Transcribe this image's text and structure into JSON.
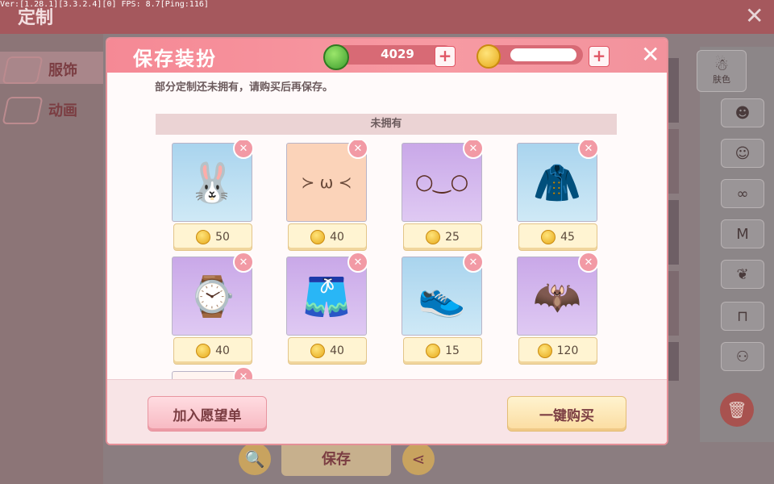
{
  "debug_text": "Ver:[1.28.1][3.3.2.4][0] FPS: 8.7[Ping:116]",
  "background": {
    "title": "定制",
    "close": "✕",
    "left_tabs": [
      {
        "label": "服饰",
        "icon": "clothing-icon"
      },
      {
        "label": "动画",
        "icon": "animation-icon"
      }
    ],
    "right_categories": [
      {
        "label": "肤色",
        "icon": "skin-color-icon",
        "glyph": "☃"
      },
      {
        "label": "",
        "icon": "face-icon",
        "glyph": "☻"
      },
      {
        "label": "",
        "icon": "face-makeup-icon",
        "glyph": "☺"
      },
      {
        "label": "",
        "icon": "mask-icon",
        "glyph": "∞"
      },
      {
        "label": "",
        "icon": "shirt-icon",
        "glyph": "M"
      },
      {
        "label": "",
        "icon": "hair-icon",
        "glyph": "❦"
      },
      {
        "label": "",
        "icon": "pants-icon",
        "glyph": "⊓"
      },
      {
        "label": "",
        "icon": "shoes-icon",
        "glyph": "⚇"
      }
    ],
    "save_label": "保存"
  },
  "modal": {
    "title": "保存装扮",
    "gems": "4029",
    "coins": "",
    "notice": "部分定制还未拥有，请购买后再保存。",
    "section_label": "未拥有",
    "items": [
      {
        "name": "bunny-ears-hair",
        "icon": "bunny-hair-icon",
        "glyph": "🐰",
        "bg": "blue",
        "price": "50"
      },
      {
        "name": "squint-face",
        "icon": "face-expression-icon",
        "glyph": "≻ ω ≺",
        "bg": "peach",
        "price": "40"
      },
      {
        "name": "round-glasses",
        "icon": "glasses-icon",
        "glyph": "○‿○",
        "bg": "purple",
        "price": "25"
      },
      {
        "name": "green-jacket",
        "icon": "jacket-icon",
        "glyph": "🧥",
        "bg": "blue",
        "price": "45"
      },
      {
        "name": "wrist-watch",
        "icon": "watch-icon",
        "glyph": "⌚",
        "bg": "purple",
        "price": "40"
      },
      {
        "name": "brown-shorts",
        "icon": "shorts-icon",
        "glyph": "🩳",
        "bg": "purple",
        "price": "40"
      },
      {
        "name": "sneakers",
        "icon": "sneakers-icon",
        "glyph": "👟",
        "bg": "blue",
        "price": "15"
      },
      {
        "name": "bat-wings",
        "icon": "wings-icon",
        "glyph": "🦇",
        "bg": "purple",
        "price": "120"
      }
    ],
    "wishlist_label": "加入愿望单",
    "buy_all_label": "一键购买",
    "close": "✕",
    "plus": "+"
  }
}
